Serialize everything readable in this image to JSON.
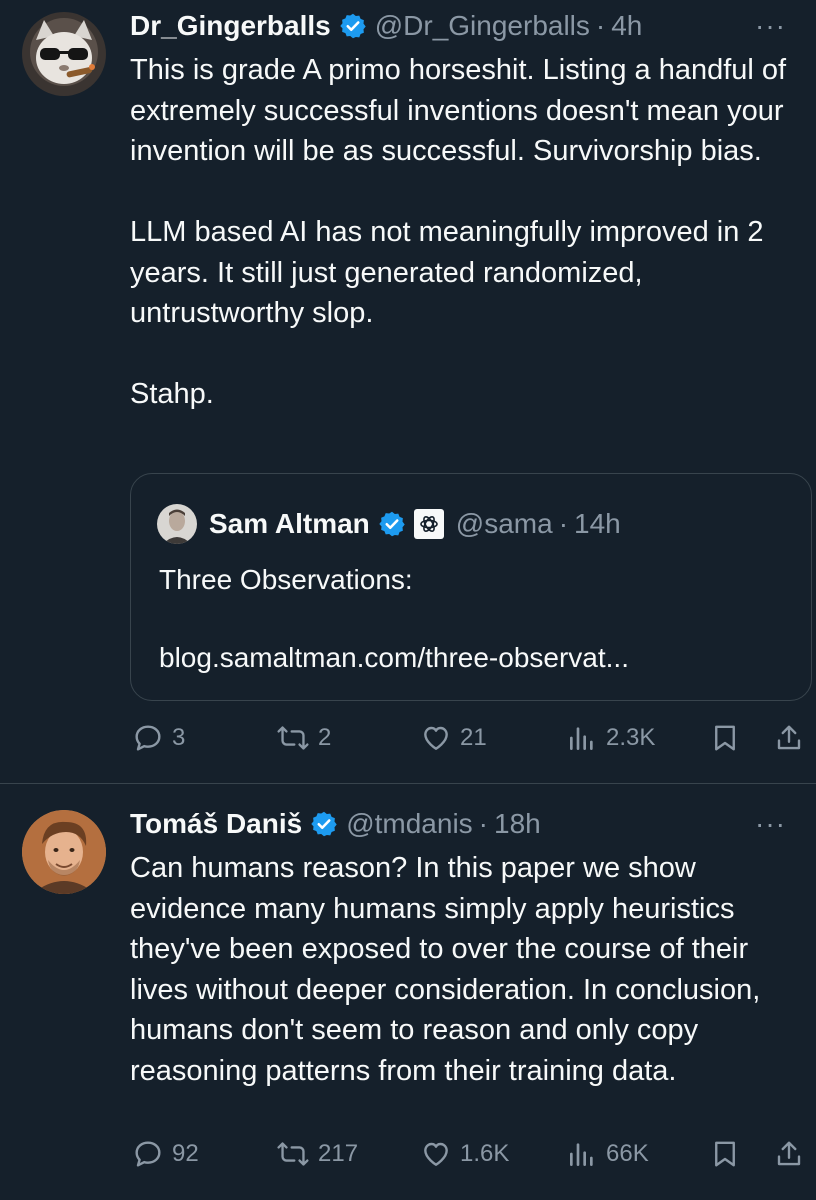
{
  "colors": {
    "background": "#15202b",
    "text": "#f7f9f9",
    "muted": "#8b98a5",
    "verified": "#1d9bf0",
    "border": "#38444d"
  },
  "tweets": [
    {
      "author": {
        "name": "Dr_Gingerballs",
        "handle": "@Dr_Gingerballs",
        "separator": "·",
        "time": "4h"
      },
      "more_label": "···",
      "text": "This is grade A primo horseshit. Listing a handful of extremely successful inventions doesn't mean your invention will be as successful. Survivorship bias.\n\nLLM based AI has not meaningfully improved in 2 years.  It still just generated randomized, untrustworthy slop.\n\nStahp.",
      "quote": {
        "author": {
          "name": "Sam Altman",
          "handle": "@sama",
          "separator": "·",
          "time": "14h"
        },
        "text": "Three Observations:",
        "link": "blog.samaltman.com/three-observat..."
      },
      "actions": {
        "replies": "3",
        "reposts": "2",
        "likes": "21",
        "views": "2.3K"
      }
    },
    {
      "author": {
        "name": "Tomáš Daniš",
        "handle": "@tmdanis",
        "separator": "·",
        "time": "18h"
      },
      "more_label": "···",
      "text": "Can humans reason? In this paper we show evidence many humans simply apply heuristics they've been exposed to over the course of their lives without deeper consideration. In conclusion, humans don't seem to reason and only copy reasoning patterns from their training data.",
      "actions": {
        "replies": "92",
        "reposts": "217",
        "likes": "1.6K",
        "views": "66K"
      }
    }
  ],
  "icons": [
    "verified-badge-icon",
    "openai-logo-icon",
    "reply-icon",
    "repost-icon",
    "like-icon",
    "views-icon",
    "bookmark-icon",
    "share-icon",
    "more-icon"
  ]
}
